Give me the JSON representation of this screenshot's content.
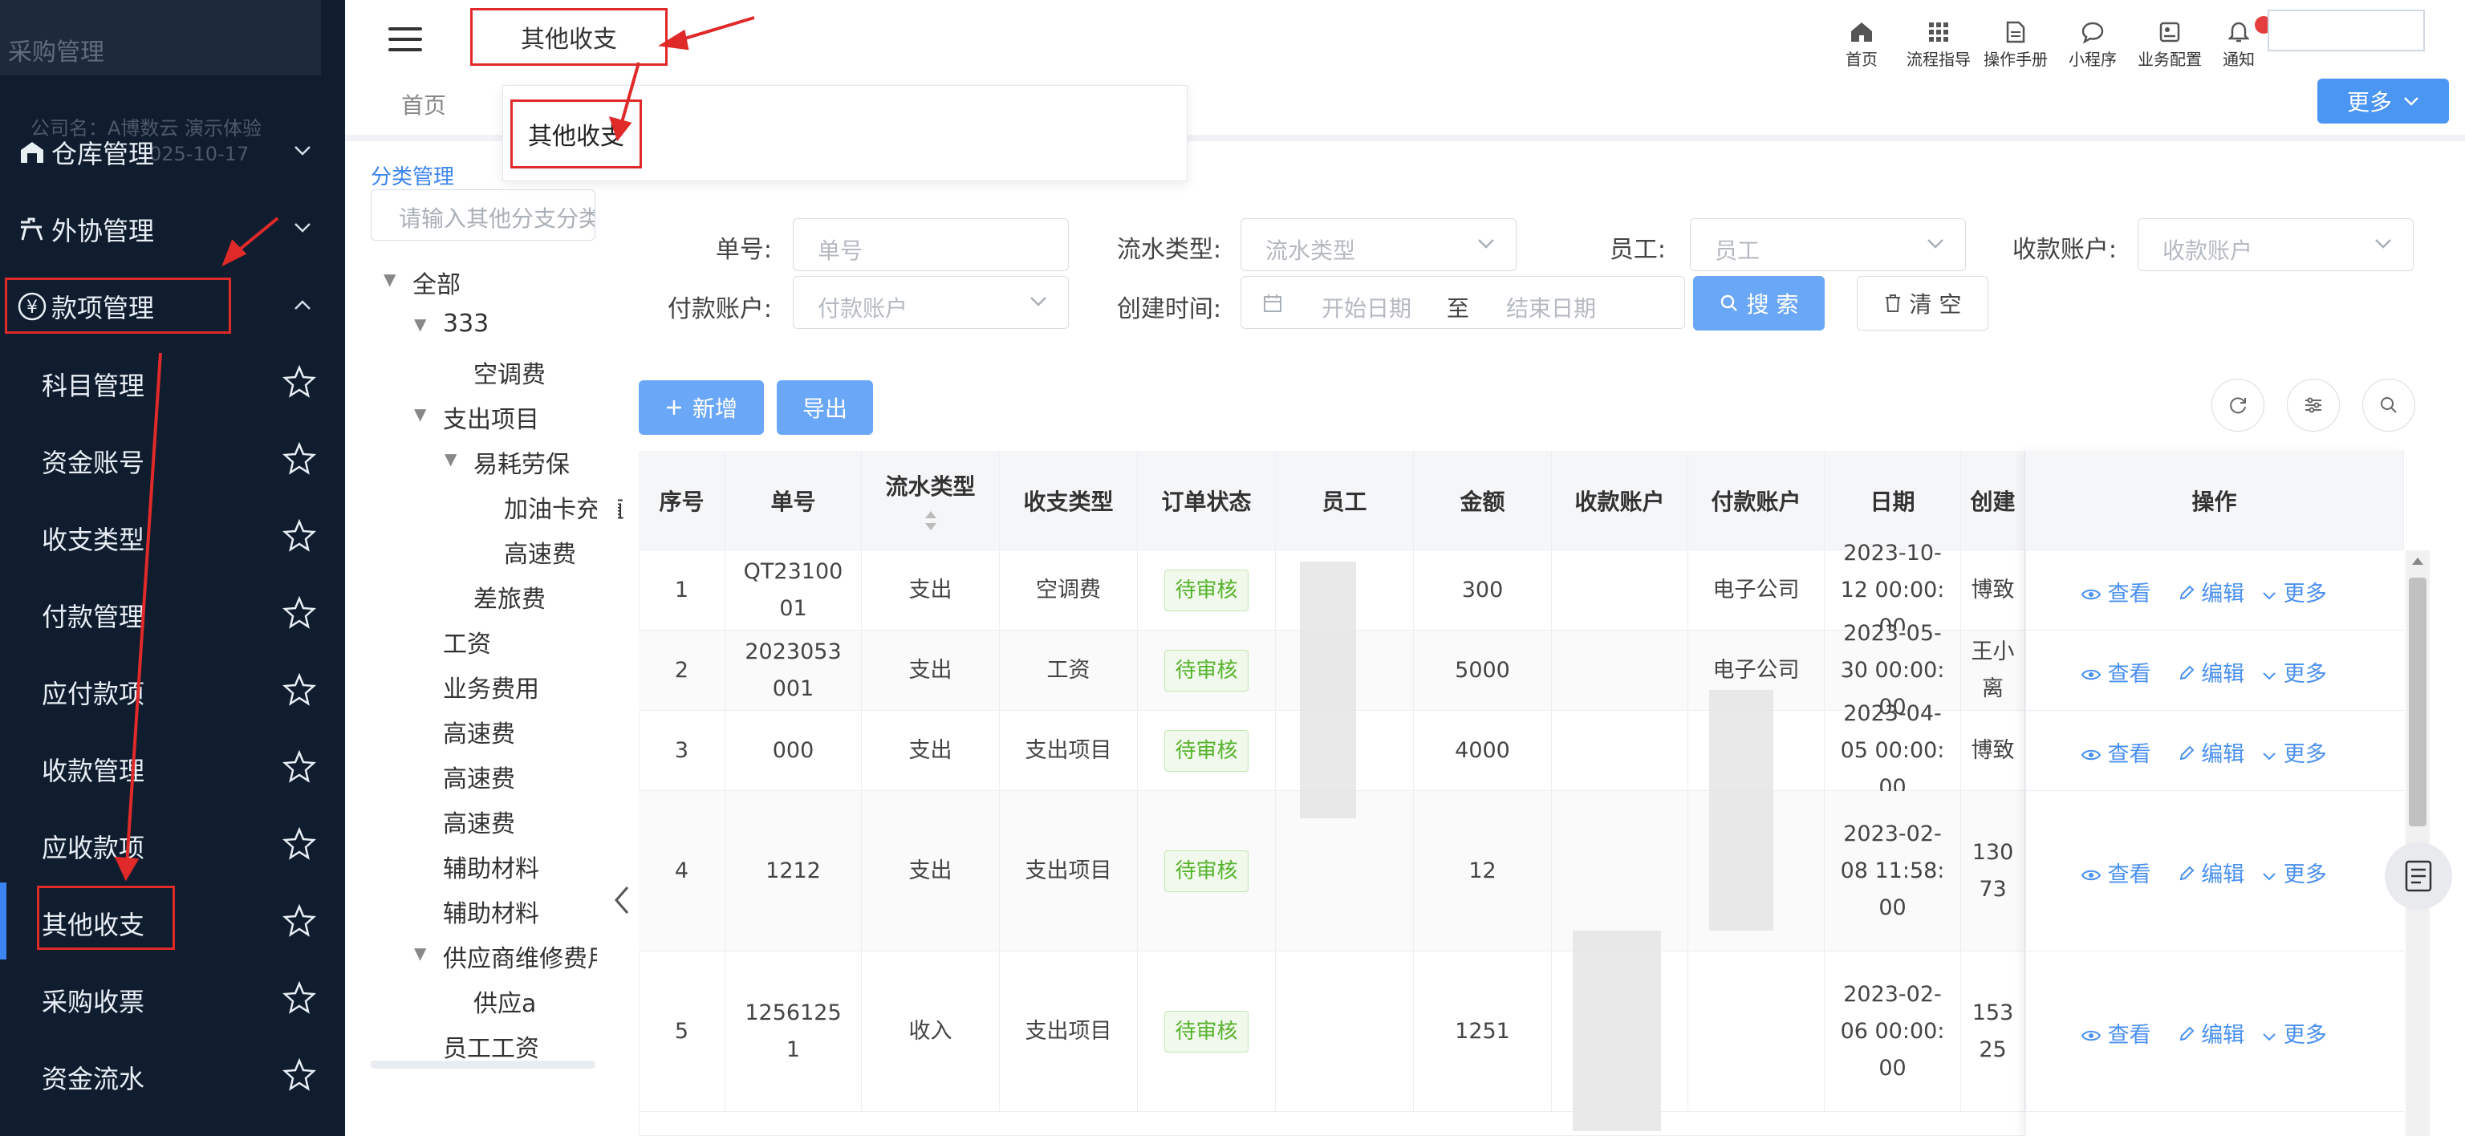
{
  "sidebar": {
    "top_ghost": "采购管理",
    "top_ghost2": "公司名：A博数云 演示体验",
    "top_ghost3": "025-10-17",
    "groups": [
      {
        "label": "仓库管理"
      },
      {
        "label": "外协管理"
      },
      {
        "label": "款项管理"
      }
    ],
    "items": [
      {
        "label": "科目管理"
      },
      {
        "label": "资金账号"
      },
      {
        "label": "收支类型"
      },
      {
        "label": "付款管理"
      },
      {
        "label": "应付款项"
      },
      {
        "label": "收款管理"
      },
      {
        "label": "应收款项"
      },
      {
        "label": "其他收支"
      },
      {
        "label": "采购收票"
      },
      {
        "label": "资金流水"
      }
    ],
    "accent": "#3b84f1"
  },
  "header": {
    "active_tab": "其他收支",
    "tools": [
      {
        "label": "首页",
        "icon": "home-icon"
      },
      {
        "label": "流程指导",
        "icon": "grid-icon"
      },
      {
        "label": "操作手册",
        "icon": "document-icon"
      },
      {
        "label": "小程序",
        "icon": "chat-icon"
      },
      {
        "label": "业务配置",
        "icon": "config-icon"
      },
      {
        "label": "通知",
        "icon": "bell-icon"
      }
    ]
  },
  "tabbar": {
    "home": "首页",
    "more": "更多"
  },
  "dropdown": {
    "item": "其他收支"
  },
  "category": {
    "title": "分类管理",
    "placeholder": "请输入其他分支分类",
    "tree": [
      {
        "label": "全部"
      },
      {
        "label": "333"
      },
      {
        "label": "空调费"
      },
      {
        "label": "支出项目"
      },
      {
        "label": "易耗劳保"
      },
      {
        "label": "加油卡充值"
      },
      {
        "label": "高速费"
      },
      {
        "label": "差旅费"
      },
      {
        "label": "工资"
      },
      {
        "label": "业务费用"
      },
      {
        "label": "高速费"
      },
      {
        "label": "高速费"
      },
      {
        "label": "高速费"
      },
      {
        "label": "辅助材料"
      },
      {
        "label": "辅助材料"
      },
      {
        "label": "供应商维修费用"
      },
      {
        "label": "供应a"
      },
      {
        "label": "员工工资"
      }
    ]
  },
  "filters": {
    "order_no": {
      "label": "单号:",
      "placeholder": "单号"
    },
    "flow_type": {
      "label": "流水类型:",
      "placeholder": "流水类型"
    },
    "employee": {
      "label": "员工:",
      "placeholder": "员工"
    },
    "receive_account": {
      "label": "收款账户:",
      "placeholder": "收款账户"
    },
    "pay_account": {
      "label": "付款账户:",
      "placeholder": "付款账户"
    },
    "created": {
      "label": "创建时间:",
      "start": "开始日期",
      "sep": "至",
      "end": "结束日期"
    },
    "search": "搜 索",
    "clear": "清 空"
  },
  "actions": {
    "add": "新增",
    "export": "导出"
  },
  "table": {
    "headers": [
      "序号",
      "单号",
      "流水类型",
      "收支类型",
      "订单状态",
      "员工",
      "金额",
      "收款账户",
      "付款账户",
      "日期",
      "创建",
      "操作"
    ],
    "rows": [
      {
        "idx": "1",
        "no": "QT2310001",
        "flow": "支出",
        "type": "空调费",
        "status": "待审核",
        "emp": "",
        "amount": "300",
        "recv": "",
        "pay": "电子公司",
        "date": "2023-10-12 00:00:00",
        "creator": "博致"
      },
      {
        "idx": "2",
        "no": "2023053001",
        "flow": "支出",
        "type": "工资",
        "status": "待审核",
        "emp": "",
        "amount": "5000",
        "recv": "",
        "pay": "电子公司",
        "date": "2023-05-30 00:00:00",
        "creator": "王小离"
      },
      {
        "idx": "3",
        "no": "000",
        "flow": "支出",
        "type": "支出项目",
        "status": "待审核",
        "emp": "",
        "amount": "4000",
        "recv": "",
        "pay": "",
        "date": "2023-04-05 00:00:00",
        "creator": "博致"
      },
      {
        "idx": "4",
        "no": "1212",
        "flow": "支出",
        "type": "支出项目",
        "status": "待审核",
        "emp": "",
        "amount": "12",
        "recv": "",
        "pay": "",
        "date": "2023-02-08 11:58:00",
        "creator": "13073"
      },
      {
        "idx": "5",
        "no": "12561251",
        "flow": "收入",
        "type": "支出项目",
        "status": "待审核",
        "emp": "",
        "amount": "1251",
        "recv": "",
        "pay": "",
        "date": "2023-02-06 00:00:00",
        "creator": "15325"
      }
    ],
    "ops": {
      "view": "查看",
      "edit": "编辑",
      "more": "更多"
    },
    "status_color": "#56b22c"
  },
  "annotation_color": "#e02a2a"
}
